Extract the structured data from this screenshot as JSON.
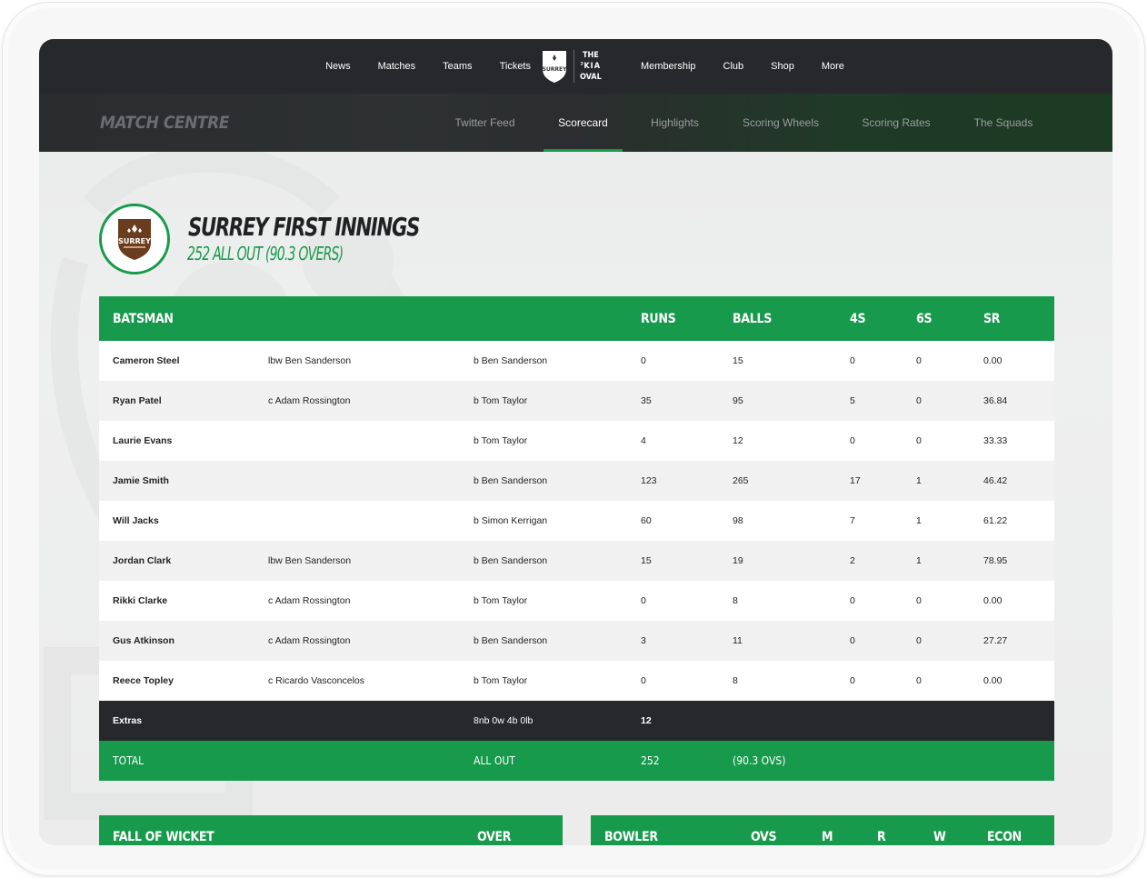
{
  "topnav": {
    "left_items": [
      "News",
      "Matches",
      "Teams",
      "Tickets"
    ],
    "right_items": [
      "Membership",
      "Club",
      "Shop",
      "More"
    ],
    "logo_text_top": "THE",
    "logo_text_bottom": "OVAL",
    "logo_crest_text": "SURREY"
  },
  "subnav": {
    "title": "MATCH CENTRE",
    "tabs": [
      "Twitter Feed",
      "Scorecard",
      "Highlights",
      "Scoring Wheels",
      "Scoring Rates",
      "The Squads"
    ],
    "active_tab": "Scorecard"
  },
  "innings": {
    "badge_text": "SURREY",
    "title": "SURREY FIRST INNINGS",
    "subtitle": "252 ALL OUT (90.3 OVERS)"
  },
  "table": {
    "headers": {
      "batsman": "BATSMAN",
      "runs": "RUNS",
      "balls": "BALLS",
      "fours": "4S",
      "sixes": "6S",
      "sr": "SR"
    },
    "rows": [
      {
        "name": "Cameron Steel",
        "how": "lbw Ben Sanderson",
        "bowler": "b Ben Sanderson",
        "runs": "0",
        "balls": "15",
        "fours": "0",
        "sixes": "0",
        "sr": "0.00"
      },
      {
        "name": "Ryan Patel",
        "how": "c Adam Rossington",
        "bowler": "b Tom Taylor",
        "runs": "35",
        "balls": "95",
        "fours": "5",
        "sixes": "0",
        "sr": "36.84"
      },
      {
        "name": "Laurie Evans",
        "how": "",
        "bowler": "b Tom Taylor",
        "runs": "4",
        "balls": "12",
        "fours": "0",
        "sixes": "0",
        "sr": "33.33"
      },
      {
        "name": "Jamie Smith",
        "how": "",
        "bowler": "b Ben Sanderson",
        "runs": "123",
        "balls": "265",
        "fours": "17",
        "sixes": "1",
        "sr": "46.42"
      },
      {
        "name": "Will Jacks",
        "how": "",
        "bowler": "b Simon Kerrigan",
        "runs": "60",
        "balls": "98",
        "fours": "7",
        "sixes": "1",
        "sr": "61.22"
      },
      {
        "name": "Jordan Clark",
        "how": "lbw Ben Sanderson",
        "bowler": "b Ben Sanderson",
        "runs": "15",
        "balls": "19",
        "fours": "2",
        "sixes": "1",
        "sr": "78.95"
      },
      {
        "name": "Rikki Clarke",
        "how": "c Adam Rossington",
        "bowler": "b Tom Taylor",
        "runs": "0",
        "balls": "8",
        "fours": "0",
        "sixes": "0",
        "sr": "0.00"
      },
      {
        "name": "Gus Atkinson",
        "how": "c Adam Rossington",
        "bowler": "b Ben Sanderson",
        "runs": "3",
        "balls": "11",
        "fours": "0",
        "sixes": "0",
        "sr": "27.27"
      },
      {
        "name": "Reece Topley",
        "how": "c Ricardo Vasconcelos",
        "bowler": "b Tom Taylor",
        "runs": "0",
        "balls": "8",
        "fours": "0",
        "sixes": "0",
        "sr": "0.00"
      }
    ],
    "extras": {
      "label": "Extras",
      "detail": "8nb 0w 4b 0lb",
      "value": "12"
    },
    "total": {
      "label": "TOTAL",
      "status": "ALL OUT",
      "runs": "252",
      "overs": "(90.3 OVS)"
    }
  },
  "fall_of_wicket": {
    "title": "FALL OF WICKET",
    "over": "OVER"
  },
  "bowling": {
    "bowler": "BOWLER",
    "ovs": "OVS",
    "m": "M",
    "r": "R",
    "w": "W",
    "econ": "ECON"
  },
  "colors": {
    "green": "#189a4c",
    "dark": "#26282b",
    "crest_brown": "#6b3d1f"
  }
}
